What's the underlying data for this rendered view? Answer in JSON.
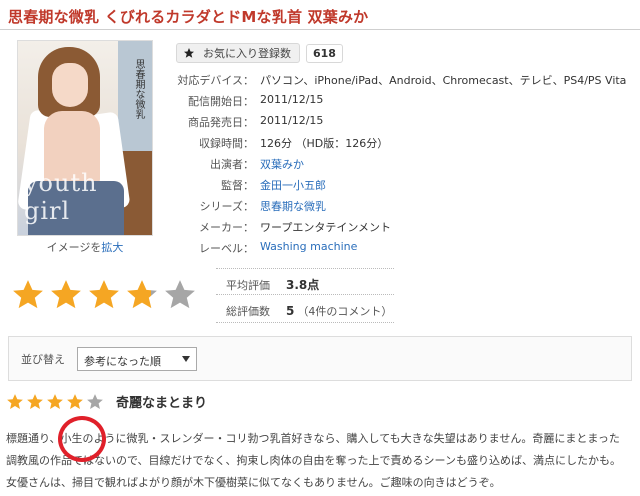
{
  "title": "思春期な微乳 くびれるカラダとドMな乳首 双葉みか",
  "cover": {
    "overlay_text": "youth girl",
    "vertical_text": "思春期な微乳",
    "caption_prefix": "イメージを",
    "caption_link": "拡大"
  },
  "favorite": {
    "label": "お気に入り登録数",
    "count": "618",
    "icon": "star-icon"
  },
  "info": [
    {
      "label": "対応デバイス：",
      "value": "パソコン、iPhone/iPad、Android、Chromecast、テレビ、PS4/PS Vita",
      "link": false
    },
    {
      "label": "配信開始日：",
      "value": "2011/12/15",
      "link": false
    },
    {
      "label": "商品発売日：",
      "value": "2011/12/15",
      "link": false
    },
    {
      "label": "収録時間：",
      "value": "126分 （HD版：126分）",
      "link": false
    },
    {
      "label": "出演者：",
      "value": "双葉みか",
      "link": true
    },
    {
      "label": "監督：",
      "value": "金田一小五郎",
      "link": true
    },
    {
      "label": "シリーズ：",
      "value": "思春期な微乳",
      "link": true
    },
    {
      "label": "メーカー：",
      "value": "ワープエンタテインメント",
      "link": false
    },
    {
      "label": "レーベル：",
      "value": "Washing machine",
      "link": true
    }
  ],
  "rating": {
    "average_label": "平均評価",
    "average_value": "3.8点",
    "total_label": "総評価数",
    "total_value": "5",
    "total_sub": "（4件のコメント）",
    "stars": 3.8
  },
  "sort": {
    "label": "並び替え",
    "selected": "参考になった順"
  },
  "review": {
    "stars": 4,
    "title": "奇麗なまとまり",
    "lines": [
      "標題通り、小生のように微乳・スレンダー・コリ勃つ乳首好きなら、購入しても大きな失望はありません。奇麗にまとまった",
      "調教風の作品ではないので、目線だけでなく、拘束し肉体の自由を奪った上で責めるシーンも盛り込めば、満点にしたかも。",
      "女優さんは、掃目で観ればよがり顔が木下優樹菜に似てなくもありません。ご趣味の向きはどうぞ。"
    ]
  },
  "colors": {
    "title": "#c0392b",
    "link": "#2a6ebb",
    "star_filled": "#f5a623",
    "star_empty": "#a6a6a6",
    "annotation": "#e0202a"
  }
}
